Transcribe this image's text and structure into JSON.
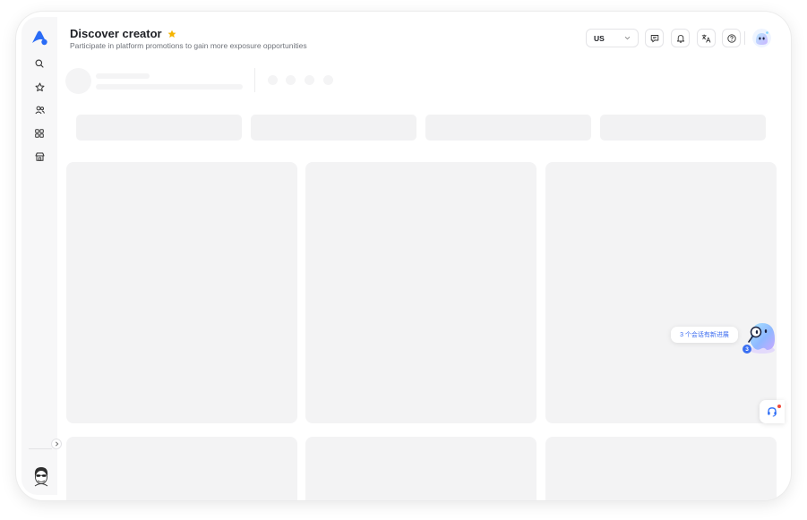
{
  "header": {
    "title": "Discover creator",
    "subtitle": "Participate in platform promotions to gain more exposure opportunities",
    "region": "US"
  },
  "icons": {
    "logo": "app-logo",
    "sidebar": [
      "search-icon",
      "star-badge-icon",
      "users-icon",
      "grid-icon",
      "shop-icon"
    ],
    "header": [
      "message-icon",
      "bell-icon",
      "translate-icon",
      "help-icon"
    ]
  },
  "assistant": {
    "bubble_text": "3 个会话有新进展",
    "badge_count": "3"
  },
  "colors": {
    "accent": "#2b6cf6",
    "star": "#f5b400",
    "skeleton": "#f3f3f4",
    "notification": "#f04a3a"
  }
}
